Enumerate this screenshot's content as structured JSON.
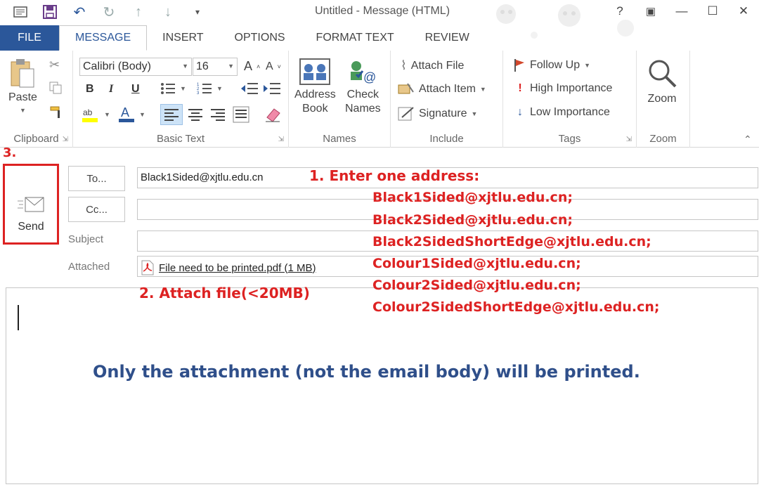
{
  "window": {
    "title": "Untitled - Message (HTML)",
    "controls": {
      "help": "?",
      "restore_ribbon": "▣",
      "minimize": "—",
      "maximize": "☐",
      "close": "✕"
    }
  },
  "tabs": [
    "FILE",
    "MESSAGE",
    "INSERT",
    "OPTIONS",
    "FORMAT TEXT",
    "REVIEW"
  ],
  "ribbon": {
    "clipboard": {
      "paste_label": "Paste",
      "group_label": "Clipboard"
    },
    "basic_text": {
      "font_name": "Calibri (Body)",
      "font_size": "16",
      "bold": "B",
      "italic": "I",
      "underline": "U",
      "group_label": "Basic Text"
    },
    "names": {
      "address_book_line1": "Address",
      "address_book_line2": "Book",
      "check_names_line1": "Check",
      "check_names_line2": "Names",
      "group_label": "Names"
    },
    "include": {
      "attach_file": "Attach File",
      "attach_item": "Attach Item",
      "signature": "Signature",
      "group_label": "Include"
    },
    "tags": {
      "follow_up": "Follow Up",
      "high_importance": "High Importance",
      "low_importance": "Low Importance",
      "group_label": "Tags"
    },
    "zoom": {
      "zoom_label": "Zoom",
      "group_label": "Zoom"
    }
  },
  "compose": {
    "send_label": "Send",
    "to_button": "To...",
    "cc_button": "Cc...",
    "subject_label": "Subject",
    "attached_label": "Attached",
    "to_value": "Black1Sided@xjtlu.edu.cn",
    "cc_value": "",
    "subject_value": "",
    "attachment": "File need to be printed.pdf (1 MB)"
  },
  "annotations": {
    "step3": "3.",
    "step1": "1. Enter one address:",
    "step2": "2. Attach file(<20MB)",
    "addresses": [
      "Black1Sided@xjtlu.edu.cn;",
      "Black2Sided@xjtlu.edu.cn;",
      "Black2SidedShortEdge@xjtlu.edu.cn;",
      "Colour1Sided@xjtlu.edu.cn;",
      "Colour2Sided@xjtlu.edu.cn;",
      "Colour2SidedShortEdge@xjtlu.edu.cn;"
    ],
    "note": "Only the attachment (not the email body) will be printed."
  },
  "colors": {
    "accent": "#2b579a",
    "annotation_red": "#dd2222",
    "note_blue": "#2f4f8a"
  }
}
